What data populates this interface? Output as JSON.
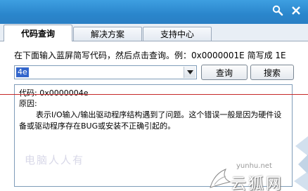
{
  "tabs": [
    {
      "label": "代码查询"
    },
    {
      "label": "解决方案"
    },
    {
      "label": "支持中心"
    }
  ],
  "instruction": "在下面输入蓝屏简写代码，然后点击查询。例：0x0000001E 简写成 1E",
  "code_input": {
    "value": "4e"
  },
  "buttons": {
    "query": "查询",
    "search": "搜索"
  },
  "result": {
    "code_line": "代码: 0x0000004e",
    "cause_label": "原因:",
    "cause_text": "表示I/O输入/输出驱动程序结构遇到了问题。这个错误一般是因为硬件设备或驱动程序存在BUG或安装不正确引起的。"
  },
  "watermark": {
    "left": "电脑人人有",
    "url": "yunhu.net",
    "brand": "云狐网"
  },
  "icons": {
    "title_search": "search-icon",
    "title_close": "close-icon",
    "combo_arrow": "chevron-down-icon"
  },
  "colors": {
    "titlebar": "#2a86cc",
    "selection": "#3366cc",
    "red_line": "#c62828"
  }
}
